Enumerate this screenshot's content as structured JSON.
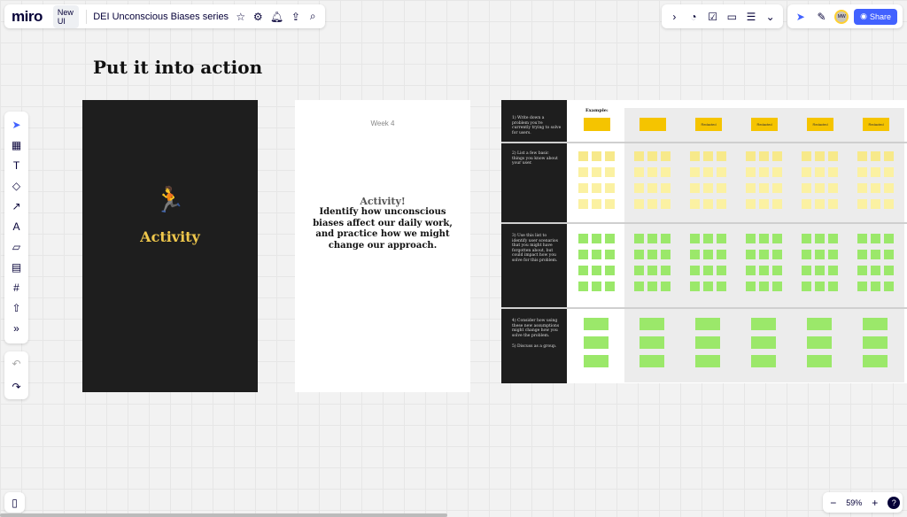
{
  "app": {
    "logo": "miro",
    "badge": "New UI",
    "board_title": "DEI Unconscious Biases series"
  },
  "share": {
    "label": "Share"
  },
  "avatar": {
    "initials": "MW"
  },
  "zoom": {
    "level": "59%",
    "help": "?"
  },
  "colors": {
    "accent": "#4262ff",
    "dark_frame": "#1e1e1e",
    "activity_gold": "#f0c84c",
    "sticky_yellow": "#fbf1a2",
    "sticky_green": "#9be86a",
    "header_yellow": "#f5c400"
  },
  "icons": {
    "topbar": [
      "star-icon",
      "settings-icon",
      "bell-icon",
      "upload-icon",
      "search-icon"
    ],
    "top_right": [
      "chevron-right-icon",
      "timer-icon",
      "vote-icon",
      "present-icon",
      "notes-icon",
      "more-icon",
      "cursor-icon",
      "reaction-icon"
    ],
    "tools": [
      "select-icon",
      "template-icon",
      "text-icon",
      "shape-icon",
      "pen-icon",
      "connection-icon",
      "sticky-note-icon",
      "comment-icon",
      "frame-icon",
      "upload-icon",
      "more-tools-icon"
    ],
    "history": [
      "undo-icon",
      "redo-icon"
    ]
  },
  "canvas": {
    "section_title": "Put it into action",
    "card_dark": {
      "title": "Activity",
      "emoji": "🏃"
    },
    "card_light": {
      "week": "Week 4",
      "heading": "Activity!",
      "body": "Identify how unconscious biases affect our daily work, and practice how we might change our approach."
    },
    "board": {
      "example_label": "Example:",
      "steps": [
        "1) Write down a problem you're currently trying to solve for users.",
        "2) List a few basic things you know about your user.",
        "3) Use this list to identify user scenarios that you might have forgotten about, but could impact how you solve for this problem.",
        "4) Consider how using these new assumptions might change how you solve the problem.",
        "5) Discuss as a group."
      ],
      "column_headers": [
        "Redacted",
        "Redacted",
        "Redacted",
        "Redacted"
      ]
    }
  }
}
